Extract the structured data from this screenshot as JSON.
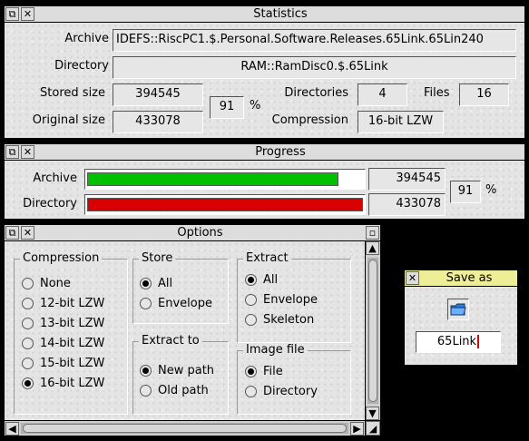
{
  "statistics": {
    "title": "Statistics",
    "archive_label": "Archive",
    "archive_value": "IDEFS::RiscPC1.$.Personal.Software.Releases.65Link.65Lin240",
    "directory_label": "Directory",
    "directory_value": "RAM::RamDisc0.$.65Link",
    "stored_label": "Stored size",
    "stored_value": "394545",
    "original_label": "Original size",
    "original_value": "433078",
    "ratio_value": "91",
    "ratio_unit": "%",
    "directories_label": "Directories",
    "directories_value": "4",
    "files_label": "Files",
    "files_value": "16",
    "compression_label": "Compression",
    "compression_value": "16-bit LZW"
  },
  "progress": {
    "title": "Progress",
    "archive_label": "Archive",
    "archive_value": "394545",
    "archive_fraction": 0.911,
    "archive_color": "#00c000",
    "directory_label": "Directory",
    "directory_value": "433078",
    "directory_fraction": 1.0,
    "directory_color": "#d80000",
    "ratio_value": "91",
    "ratio_unit": "%"
  },
  "options": {
    "title": "Options",
    "compression": {
      "title": "Compression",
      "items": [
        "None",
        "12-bit LZW",
        "13-bit LZW",
        "14-bit LZW",
        "15-bit LZW",
        "16-bit LZW"
      ],
      "selected": "16-bit LZW"
    },
    "store": {
      "title": "Store",
      "items": [
        "All",
        "Envelope"
      ],
      "selected": "All"
    },
    "extract": {
      "title": "Extract",
      "items": [
        "All",
        "Envelope",
        "Skeleton"
      ],
      "selected": "All"
    },
    "extract_to": {
      "title": "Extract to",
      "items": [
        "New path",
        "Old path"
      ],
      "selected": "New path"
    },
    "image_file": {
      "title": "Image file",
      "items": [
        "File",
        "Directory"
      ],
      "selected": "File"
    }
  },
  "save_as": {
    "title": "Save as",
    "filename": "65Link",
    "file_icon": "directory-icon",
    "title_color": "#eeee99"
  },
  "icons": {
    "back": "back-icon",
    "close": "close-icon",
    "toggle_size": "toggle-size-icon",
    "scroll_up": "arrow-up-icon",
    "scroll_down": "arrow-down-icon",
    "scroll_left": "arrow-left-icon",
    "scroll_right": "arrow-right-icon"
  }
}
